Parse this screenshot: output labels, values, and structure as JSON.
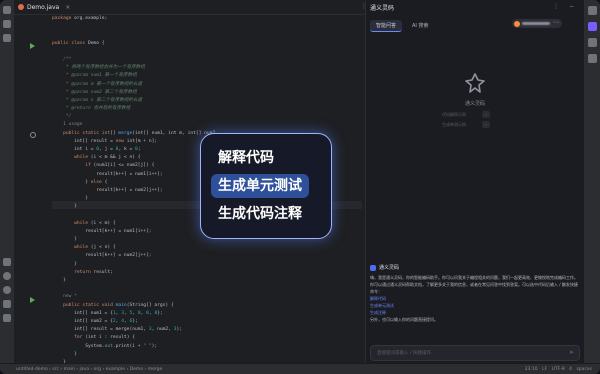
{
  "editor": {
    "tab_label": "Demo.java",
    "code_lines": [
      {
        "parts": [
          [
            "k",
            "package "
          ],
          [
            "",
            "org.example;"
          ]
        ]
      },
      {
        "parts": []
      },
      {
        "parts": []
      },
      {
        "parts": [
          [
            "k",
            "public class "
          ],
          [
            "",
            "Demo {"
          ]
        ]
      },
      {
        "parts": []
      },
      {
        "parts": [
          [
            "c",
            "    /**"
          ]
        ]
      },
      {
        "parts": [
          [
            "c",
            "     * 将两个有序数组合并为一个有序数组"
          ]
        ]
      },
      {
        "parts": [
          [
            "c",
            "     * @param num1 第一个有序数组"
          ]
        ]
      },
      {
        "parts": [
          [
            "c",
            "     * @param m 第一个有序数组的长度"
          ]
        ]
      },
      {
        "parts": [
          [
            "c",
            "     * @param num2 第二个有序数组"
          ]
        ]
      },
      {
        "parts": [
          [
            "c",
            "     * @param n 第二个有序数组的长度"
          ]
        ]
      },
      {
        "parts": [
          [
            "c",
            "     * @return 合并后的有序数组"
          ]
        ]
      },
      {
        "parts": [
          [
            "c",
            "     */"
          ]
        ]
      },
      {
        "parts": [
          [
            "dim",
            "    1 usage"
          ]
        ]
      },
      {
        "parts": [
          [
            "k",
            "    public static int"
          ],
          [
            "",
            "[] "
          ],
          [
            "f",
            "merge"
          ],
          [
            "",
            "(int[] num1, int m, int[] num2"
          ]
        ]
      },
      {
        "parts": [
          [
            "",
            "        int[] result = "
          ],
          [
            "k",
            "new "
          ],
          [
            "",
            "int[m + n];"
          ]
        ]
      },
      {
        "parts": [
          [
            "",
            "        int i = "
          ],
          [
            "n",
            "0"
          ],
          [
            "",
            ", j = "
          ],
          [
            "n",
            "0"
          ],
          [
            "",
            ", k = "
          ],
          [
            "n",
            "0"
          ],
          [
            "",
            ";"
          ]
        ]
      },
      {
        "parts": [
          [
            "k",
            "        while "
          ],
          [
            "",
            "(i < m && j < n) {"
          ]
        ]
      },
      {
        "parts": [
          [
            "k",
            "            if "
          ],
          [
            "",
            "(num1[i] <= num2[j]) {"
          ]
        ]
      },
      {
        "parts": [
          [
            "",
            "                result[k++] = num1[i++];"
          ]
        ]
      },
      {
        "parts": [
          [
            "",
            "            } "
          ],
          [
            "k",
            "else "
          ],
          [
            "",
            "{"
          ]
        ]
      },
      {
        "parts": [
          [
            "",
            "                result[k++] = num2[j++];"
          ]
        ]
      },
      {
        "parts": [
          [
            "",
            "            }"
          ]
        ]
      },
      {
        "parts": [
          [
            "",
            "        }"
          ]
        ]
      },
      {
        "parts": []
      },
      {
        "parts": [
          [
            "k",
            "        while "
          ],
          [
            "",
            "(i < m) {"
          ]
        ]
      },
      {
        "parts": [
          [
            "",
            "            result[k++] = num1[i++];"
          ]
        ]
      },
      {
        "parts": [
          [
            "",
            "        }"
          ]
        ]
      },
      {
        "parts": [
          [
            "k",
            "        while "
          ],
          [
            "",
            "(j < n) {"
          ]
        ]
      },
      {
        "parts": [
          [
            "",
            "            result[k++] = num2[j++];"
          ]
        ]
      },
      {
        "parts": [
          [
            "",
            "        }"
          ]
        ]
      },
      {
        "parts": [
          [
            "k",
            "        return "
          ],
          [
            "",
            "result;"
          ]
        ]
      },
      {
        "parts": [
          [
            "",
            "    }"
          ]
        ]
      },
      {
        "parts": []
      },
      {
        "parts": [
          [
            "dim",
            "    new *"
          ]
        ]
      },
      {
        "parts": [
          [
            "k",
            "    public static void "
          ],
          [
            "f",
            "main"
          ],
          [
            "",
            "(String[] args) {"
          ]
        ]
      },
      {
        "parts": [
          [
            "",
            "        int[] num1 = {"
          ],
          [
            "n",
            "1"
          ],
          [
            "",
            ", "
          ],
          [
            "n",
            "3"
          ],
          [
            "",
            ", "
          ],
          [
            "n",
            "5"
          ],
          [
            "",
            ", "
          ],
          [
            "n",
            "0"
          ],
          [
            "",
            ", "
          ],
          [
            "n",
            "0"
          ],
          [
            "",
            ", "
          ],
          [
            "n",
            "0"
          ],
          [
            "",
            "};"
          ]
        ]
      },
      {
        "parts": [
          [
            "",
            "        int[] num2 = {"
          ],
          [
            "n",
            "2"
          ],
          [
            "",
            ", "
          ],
          [
            "n",
            "4"
          ],
          [
            "",
            ", "
          ],
          [
            "n",
            "6"
          ],
          [
            "",
            "};"
          ]
        ]
      },
      {
        "parts": [
          [
            "",
            "        int[] result = merge(num1, "
          ],
          [
            "n",
            "3"
          ],
          [
            "",
            ", num2, "
          ],
          [
            "n",
            "3"
          ],
          [
            "",
            ");"
          ]
        ]
      },
      {
        "parts": [
          [
            "k",
            "        for "
          ],
          [
            "",
            "(int i : result) {"
          ]
        ]
      },
      {
        "parts": [
          [
            "",
            "            System."
          ],
          [
            "d",
            "out"
          ],
          [
            "",
            ".print(i + "
          ],
          [
            "s",
            "\" \""
          ],
          [
            "",
            ");"
          ]
        ]
      },
      {
        "parts": [
          [
            "",
            "        }"
          ]
        ]
      },
      {
        "parts": [
          [
            "",
            "    }"
          ]
        ]
      },
      {
        "parts": [
          [
            "",
            "}"
          ]
        ]
      }
    ]
  },
  "panel": {
    "title": "通义灵码",
    "controls": "⋮  −",
    "tabs": [
      "智能问答",
      "AI 搜索"
    ],
    "logo_text": "通义灵码",
    "suggestions": [
      "代码解释示例",
      "生成单测示例"
    ],
    "answer": {
      "author": "通义灵码",
      "intro": "嗨，我是通义灵码，你的智能编码助手。你可以问我关于编程相关的问题，我们一起更高效、更愉悦地完成编码工作。你可以通过通义灵码帮助文档，了解更多关于我的信息，或者在常见问答中找到答案。可以选中代码后输入 / 触发快捷命令：",
      "commands": [
        "解释代码",
        "生成单元测试",
        "生成注释"
      ],
      "outro": "另外，也可以输入你的问题直接提问。"
    },
    "input_placeholder": "直接提问或输入 / 快捷操作",
    "send_icon": "➤"
  },
  "popup": {
    "options": [
      "解释代码",
      "生成单元测试",
      "生成代码注释"
    ],
    "selected_index": 1
  },
  "status": {
    "breadcrumb": "untitled-demo  ›  src  ›  main  ›  java  ›  org  ›  example  ›  Demo  ›  merge",
    "right": "23:10  LF  UTF-8  4 spaces"
  },
  "icons": [
    "project-icon",
    "commit-icon",
    "structure-icon",
    "run-icon",
    "terminal-icon",
    "problems-icon",
    "git-icon",
    "assistant-icon",
    "notification-icon",
    "database-icon"
  ]
}
